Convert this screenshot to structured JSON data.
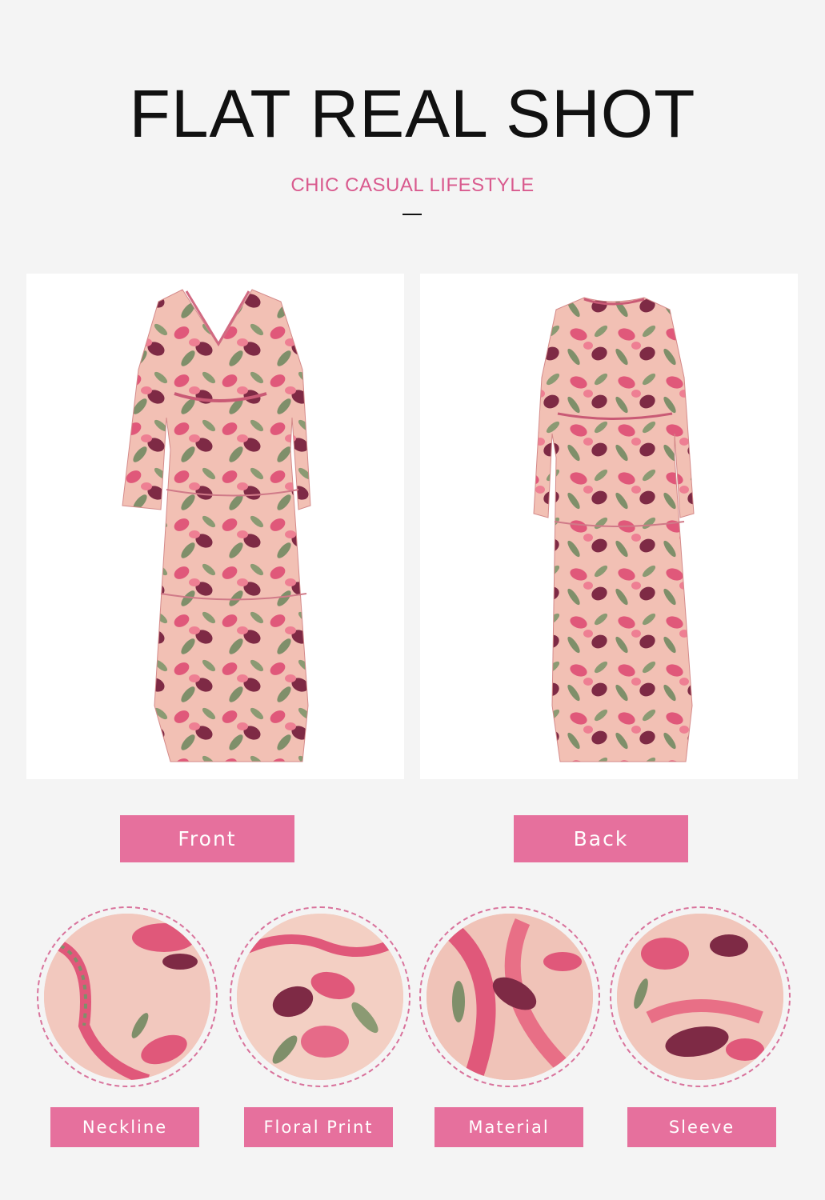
{
  "header": {
    "title": "FLAT REAL SHOT",
    "subtitle": "CHIC CASUAL LIFESTYLE"
  },
  "views": [
    {
      "label": "Front",
      "image": "front-dress-photo"
    },
    {
      "label": "Back",
      "image": "back-dress-photo"
    }
  ],
  "details": [
    {
      "label": "Neckline",
      "image": "neckline-detail-photo"
    },
    {
      "label": "Floral Print",
      "image": "floral-print-detail-photo"
    },
    {
      "label": "Material",
      "image": "material-detail-photo"
    },
    {
      "label": "Sleeve",
      "image": "sleeve-detail-photo"
    }
  ],
  "colors": {
    "accent": "#e6709d",
    "subtitle": "#d95a8e",
    "background": "#f4f4f4",
    "fabric": "#f1bfb5",
    "floral_pink": "#e0587a",
    "floral_wine": "#7e2a45",
    "leaf": "#7f8f6a"
  }
}
